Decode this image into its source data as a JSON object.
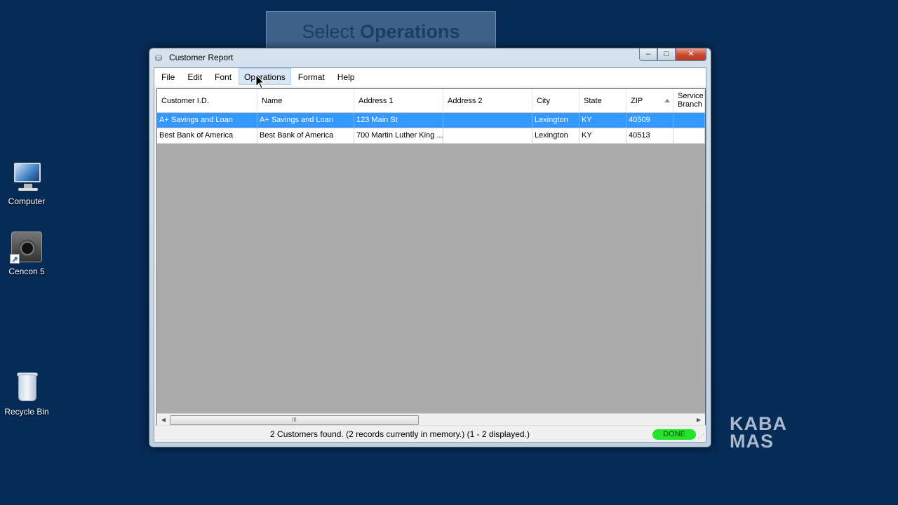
{
  "desktop": {
    "icons": [
      {
        "label": "Computer"
      },
      {
        "label": "Cencon 5"
      },
      {
        "label": "Recycle Bin"
      }
    ]
  },
  "callout": {
    "text_prefix": "Select ",
    "text_bold": "Operations"
  },
  "window": {
    "title": "Customer Report",
    "buttons": {
      "minimize": "‒",
      "maximize": "□",
      "close": "✕"
    }
  },
  "menu": {
    "items": [
      "File",
      "Edit",
      "Font",
      "Operations",
      "Format",
      "Help"
    ],
    "hovered": "Operations"
  },
  "table": {
    "columns": [
      "Customer I.D.",
      "Name",
      "Address 1",
      "Address 2",
      "City",
      "State",
      "ZIP",
      "Service Branch"
    ],
    "sorted_column": "ZIP",
    "rows": [
      {
        "selected": true,
        "cells": [
          "A+ Savings and Loan",
          "A+ Savings and Loan",
          "123 Main St",
          "",
          "Lexington",
          "KY",
          "40509",
          ""
        ]
      },
      {
        "selected": false,
        "cells": [
          "Best Bank of America",
          "Best Bank of America",
          "700 Martin Luther King ...",
          "",
          "Lexington",
          "KY",
          "40513",
          ""
        ]
      }
    ]
  },
  "scrollbar": {
    "thumb_label": "III"
  },
  "status": {
    "text": "2 Customers found.  (2 records currently in memory.)  (1 - 2 displayed.)",
    "badge": "DONE",
    "badge_color": "#22e52a"
  },
  "logo": {
    "line1": "KABA",
    "line2": "MAS"
  },
  "colors": {
    "desktop": "#062b56",
    "selection": "#3399ff",
    "close_button": "#c74a2f"
  }
}
